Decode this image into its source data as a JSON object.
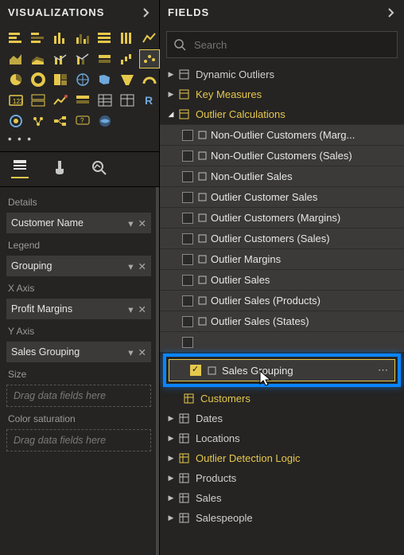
{
  "visualizations": {
    "header": "VISUALIZATIONS",
    "ellipsis": "• • •",
    "wells": {
      "details_label": "Details",
      "details_value": "Customer Name",
      "legend_label": "Legend",
      "legend_value": "Grouping",
      "xaxis_label": "X Axis",
      "xaxis_value": "Profit Margins",
      "yaxis_label": "Y Axis",
      "yaxis_value": "Sales Grouping",
      "size_label": "Size",
      "size_placeholder": "Drag data fields here",
      "colorsat_label": "Color saturation",
      "colorsat_placeholder": "Drag data fields here"
    }
  },
  "fields": {
    "header": "FIELDS",
    "search_placeholder": "Search",
    "tables": {
      "dynamic_outliers": "Dynamic Outliers",
      "key_measures": "Key Measures",
      "outlier_calculations": "Outlier Calculations",
      "customers": "Customers",
      "dates": "Dates",
      "locations": "Locations",
      "outlier_detection_logic": "Outlier Detection Logic",
      "products": "Products",
      "sales": "Sales",
      "salespeople": "Salespeople"
    },
    "columns": {
      "c0": "Non-Outlier Customers (Marg...",
      "c1": "Non-Outlier Customers (Sales)",
      "c2": "Non-Outlier Sales",
      "c3": "Outlier Customer Sales",
      "c4": "Outlier Customers (Margins)",
      "c5": "Outlier Customers (Sales)",
      "c6": "Outlier Margins",
      "c7": "Outlier Sales",
      "c8": "Outlier Sales (Products)",
      "c9": "Outlier Sales (States)",
      "selected": "Sales Grouping"
    }
  }
}
